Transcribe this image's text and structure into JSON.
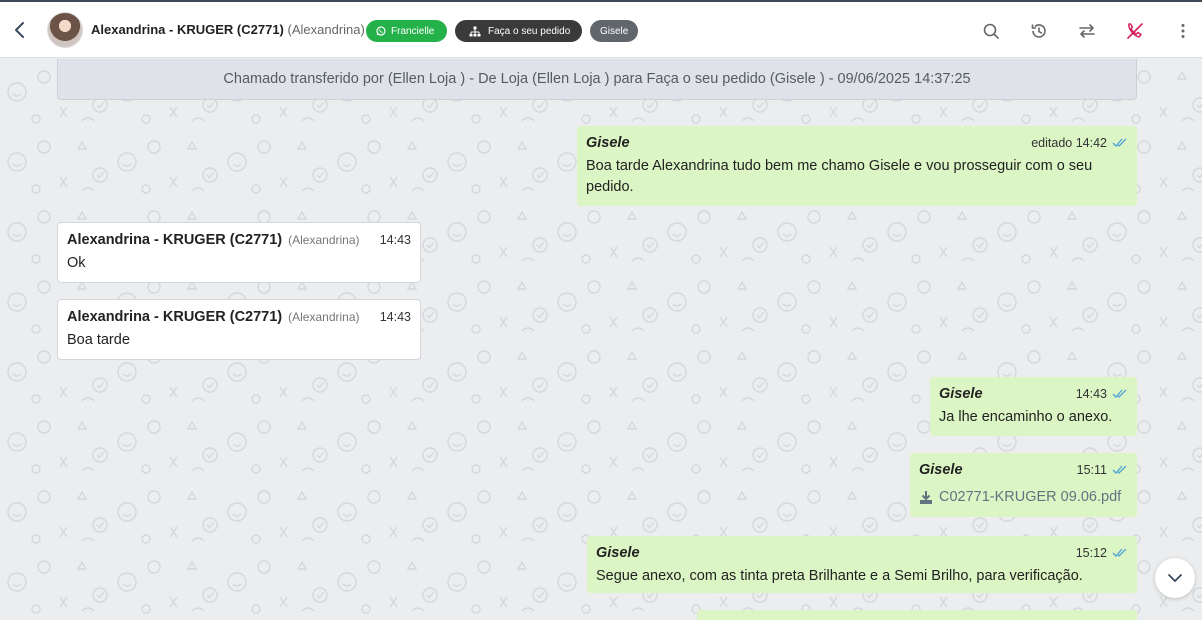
{
  "header": {
    "contact_name": "Alexandrina - KRUGER (C2771)",
    "contact_alias": "(Alexandrina)",
    "tags": {
      "channel": "Francielle",
      "queue": "Faça o seu pedido",
      "agent": "Gisele"
    },
    "icons": [
      "back-icon",
      "search-icon",
      "history-icon",
      "transfer-icon",
      "end-call-icon",
      "more-icon"
    ]
  },
  "system_message": "Chamado transferido por (Ellen Loja ) - De Loja (Ellen Loja ) para Faça o seu pedido (Gisele ) - 09/06/2025 14:37:25",
  "messages": [
    {
      "direction": "out",
      "author": "Gisele",
      "meta": "editado 14:42",
      "text": "Boa tarde Alexandrina tudo bem me chamo Gisele e vou prosseguir com o seu pedido."
    },
    {
      "direction": "in",
      "author": "Alexandrina - KRUGER (C2771)",
      "alias": "(Alexandrina)",
      "time": "14:43",
      "text": "Ok"
    },
    {
      "direction": "in",
      "author": "Alexandrina - KRUGER (C2771)",
      "alias": "(Alexandrina)",
      "time": "14:43",
      "text": "Boa tarde"
    },
    {
      "direction": "out",
      "author": "Gisele",
      "time": "14:43",
      "text": "Ja lhe encaminho o anexo."
    },
    {
      "direction": "out",
      "author": "Gisele",
      "time": "15:11",
      "file": "C02771-KRUGER 09.06.pdf"
    },
    {
      "direction": "out",
      "author": "Gisele",
      "time": "15:12",
      "text": "Segue anexo, com as tinta preta Brilhante e a Semi Brilho, para verificação."
    }
  ],
  "colors": {
    "outgoing_bubble": "#dcf5c4",
    "incoming_bubble": "#ffffff",
    "channel_tag": "#25b14a",
    "read_ticks": "#4fa3d6",
    "end_call": "#d6215c"
  }
}
